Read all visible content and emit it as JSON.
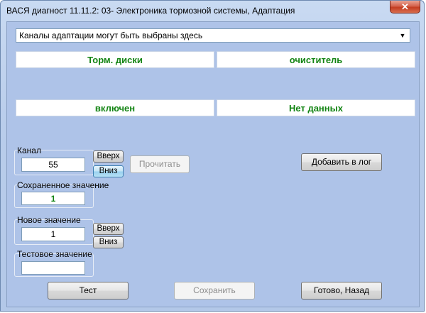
{
  "window": {
    "title": "ВАСЯ диагност 11.11.2: 03- Электроника тормозной системы, Адаптация",
    "close_glyph": "✕"
  },
  "channel_select": {
    "value": "Каналы адаптации могут быть выбраны здесь",
    "arrow_icon": "chevron-down-icon"
  },
  "info": {
    "top_left": "Торм. диски",
    "top_right": "очиститель",
    "bottom_left": "включен",
    "bottom_right": "Нет данных"
  },
  "channel": {
    "label": "Канал",
    "value": "55",
    "up_label": "Вверх",
    "down_label": "Вниз"
  },
  "stored": {
    "label": "Сохраненное значение",
    "value": "1"
  },
  "new_value": {
    "label": "Новое значение",
    "value": "1",
    "up_label": "Вверх",
    "down_label": "Вниз"
  },
  "test_value": {
    "label": "Тестовое значение",
    "value": ""
  },
  "buttons": {
    "read": "Прочитать",
    "add_log": "Добавить в лог",
    "test": "Тест",
    "save": "Сохранить",
    "done": "Готово, Назад"
  },
  "colors": {
    "value_text": "#138413",
    "window_bg": "#aec3e8"
  }
}
